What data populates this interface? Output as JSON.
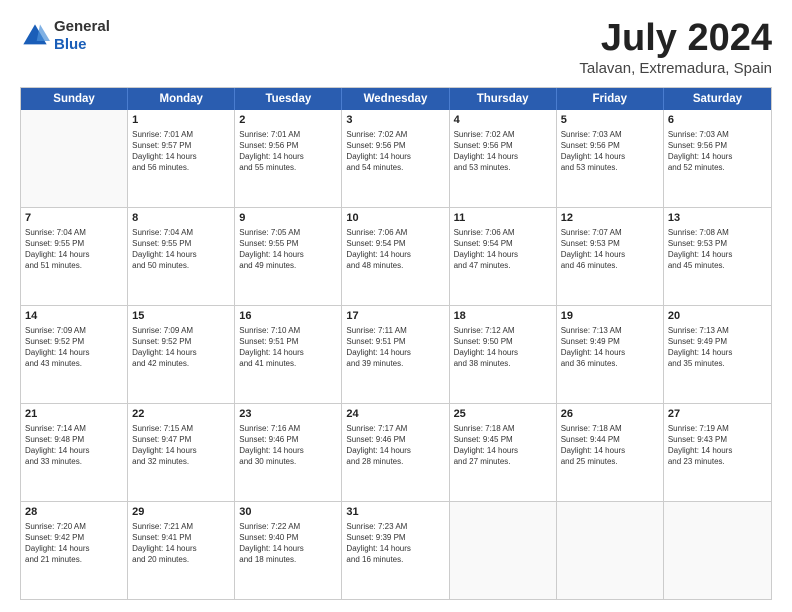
{
  "header": {
    "logo_line1": "General",
    "logo_line2": "Blue",
    "month_year": "July 2024",
    "location": "Talavan, Extremadura, Spain"
  },
  "weekdays": [
    "Sunday",
    "Monday",
    "Tuesday",
    "Wednesday",
    "Thursday",
    "Friday",
    "Saturday"
  ],
  "rows": [
    [
      {
        "day": "",
        "info": ""
      },
      {
        "day": "1",
        "info": "Sunrise: 7:01 AM\nSunset: 9:57 PM\nDaylight: 14 hours\nand 56 minutes."
      },
      {
        "day": "2",
        "info": "Sunrise: 7:01 AM\nSunset: 9:56 PM\nDaylight: 14 hours\nand 55 minutes."
      },
      {
        "day": "3",
        "info": "Sunrise: 7:02 AM\nSunset: 9:56 PM\nDaylight: 14 hours\nand 54 minutes."
      },
      {
        "day": "4",
        "info": "Sunrise: 7:02 AM\nSunset: 9:56 PM\nDaylight: 14 hours\nand 53 minutes."
      },
      {
        "day": "5",
        "info": "Sunrise: 7:03 AM\nSunset: 9:56 PM\nDaylight: 14 hours\nand 53 minutes."
      },
      {
        "day": "6",
        "info": "Sunrise: 7:03 AM\nSunset: 9:56 PM\nDaylight: 14 hours\nand 52 minutes."
      }
    ],
    [
      {
        "day": "7",
        "info": "Sunrise: 7:04 AM\nSunset: 9:55 PM\nDaylight: 14 hours\nand 51 minutes."
      },
      {
        "day": "8",
        "info": "Sunrise: 7:04 AM\nSunset: 9:55 PM\nDaylight: 14 hours\nand 50 minutes."
      },
      {
        "day": "9",
        "info": "Sunrise: 7:05 AM\nSunset: 9:55 PM\nDaylight: 14 hours\nand 49 minutes."
      },
      {
        "day": "10",
        "info": "Sunrise: 7:06 AM\nSunset: 9:54 PM\nDaylight: 14 hours\nand 48 minutes."
      },
      {
        "day": "11",
        "info": "Sunrise: 7:06 AM\nSunset: 9:54 PM\nDaylight: 14 hours\nand 47 minutes."
      },
      {
        "day": "12",
        "info": "Sunrise: 7:07 AM\nSunset: 9:53 PM\nDaylight: 14 hours\nand 46 minutes."
      },
      {
        "day": "13",
        "info": "Sunrise: 7:08 AM\nSunset: 9:53 PM\nDaylight: 14 hours\nand 45 minutes."
      }
    ],
    [
      {
        "day": "14",
        "info": "Sunrise: 7:09 AM\nSunset: 9:52 PM\nDaylight: 14 hours\nand 43 minutes."
      },
      {
        "day": "15",
        "info": "Sunrise: 7:09 AM\nSunset: 9:52 PM\nDaylight: 14 hours\nand 42 minutes."
      },
      {
        "day": "16",
        "info": "Sunrise: 7:10 AM\nSunset: 9:51 PM\nDaylight: 14 hours\nand 41 minutes."
      },
      {
        "day": "17",
        "info": "Sunrise: 7:11 AM\nSunset: 9:51 PM\nDaylight: 14 hours\nand 39 minutes."
      },
      {
        "day": "18",
        "info": "Sunrise: 7:12 AM\nSunset: 9:50 PM\nDaylight: 14 hours\nand 38 minutes."
      },
      {
        "day": "19",
        "info": "Sunrise: 7:13 AM\nSunset: 9:49 PM\nDaylight: 14 hours\nand 36 minutes."
      },
      {
        "day": "20",
        "info": "Sunrise: 7:13 AM\nSunset: 9:49 PM\nDaylight: 14 hours\nand 35 minutes."
      }
    ],
    [
      {
        "day": "21",
        "info": "Sunrise: 7:14 AM\nSunset: 9:48 PM\nDaylight: 14 hours\nand 33 minutes."
      },
      {
        "day": "22",
        "info": "Sunrise: 7:15 AM\nSunset: 9:47 PM\nDaylight: 14 hours\nand 32 minutes."
      },
      {
        "day": "23",
        "info": "Sunrise: 7:16 AM\nSunset: 9:46 PM\nDaylight: 14 hours\nand 30 minutes."
      },
      {
        "day": "24",
        "info": "Sunrise: 7:17 AM\nSunset: 9:46 PM\nDaylight: 14 hours\nand 28 minutes."
      },
      {
        "day": "25",
        "info": "Sunrise: 7:18 AM\nSunset: 9:45 PM\nDaylight: 14 hours\nand 27 minutes."
      },
      {
        "day": "26",
        "info": "Sunrise: 7:18 AM\nSunset: 9:44 PM\nDaylight: 14 hours\nand 25 minutes."
      },
      {
        "day": "27",
        "info": "Sunrise: 7:19 AM\nSunset: 9:43 PM\nDaylight: 14 hours\nand 23 minutes."
      }
    ],
    [
      {
        "day": "28",
        "info": "Sunrise: 7:20 AM\nSunset: 9:42 PM\nDaylight: 14 hours\nand 21 minutes."
      },
      {
        "day": "29",
        "info": "Sunrise: 7:21 AM\nSunset: 9:41 PM\nDaylight: 14 hours\nand 20 minutes."
      },
      {
        "day": "30",
        "info": "Sunrise: 7:22 AM\nSunset: 9:40 PM\nDaylight: 14 hours\nand 18 minutes."
      },
      {
        "day": "31",
        "info": "Sunrise: 7:23 AM\nSunset: 9:39 PM\nDaylight: 14 hours\nand 16 minutes."
      },
      {
        "day": "",
        "info": ""
      },
      {
        "day": "",
        "info": ""
      },
      {
        "day": "",
        "info": ""
      }
    ]
  ]
}
